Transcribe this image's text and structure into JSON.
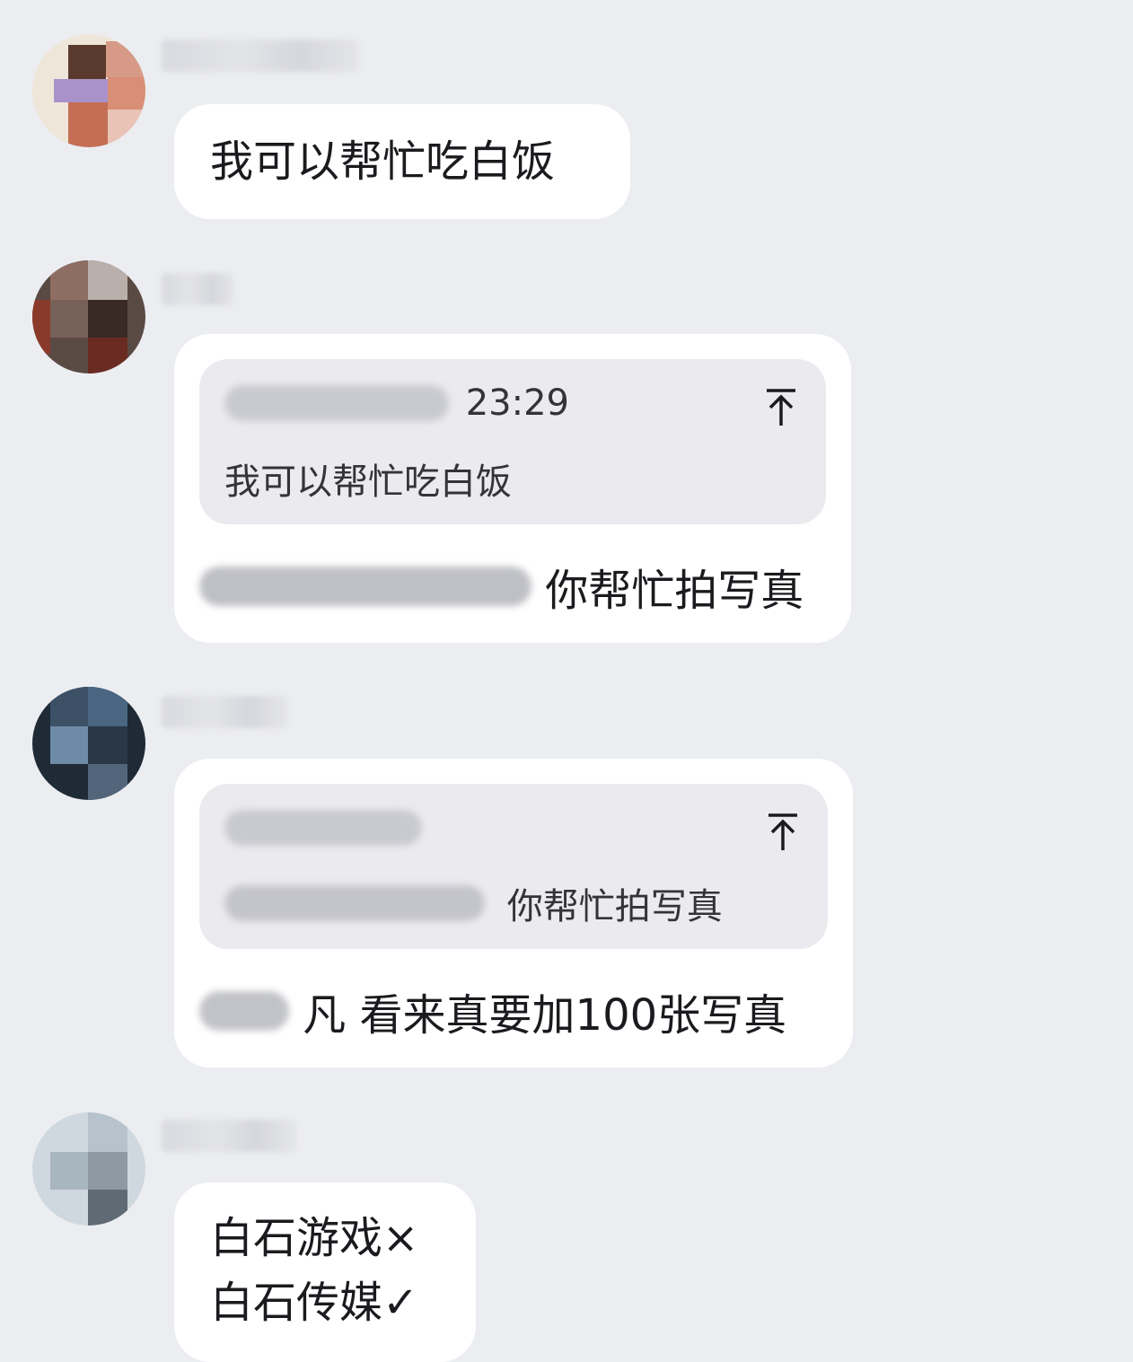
{
  "messages": [
    {
      "type": "text",
      "avatar": "user-avatar-1",
      "text": "我可以帮忙吃白饭"
    },
    {
      "type": "reply",
      "avatar": "user-avatar-2",
      "quote": {
        "time": "23:29",
        "text": "我可以帮忙吃白饭",
        "icon": "jump-to-original-icon"
      },
      "reply_suffix": "你帮忙拍写真"
    },
    {
      "type": "reply",
      "avatar": "user-avatar-3",
      "quote": {
        "text_suffix": "你帮忙拍写真",
        "icon": "jump-to-original-icon"
      },
      "reply_suffix": "凡 看来真要加100张写真"
    },
    {
      "type": "text",
      "avatar": "user-avatar-4",
      "lines": [
        "白石游戏×",
        "白石传媒✓"
      ]
    }
  ],
  "colors": {
    "background": "#ecedf1",
    "bubble": "#ffffff",
    "quote_bg": "#ebebef"
  }
}
